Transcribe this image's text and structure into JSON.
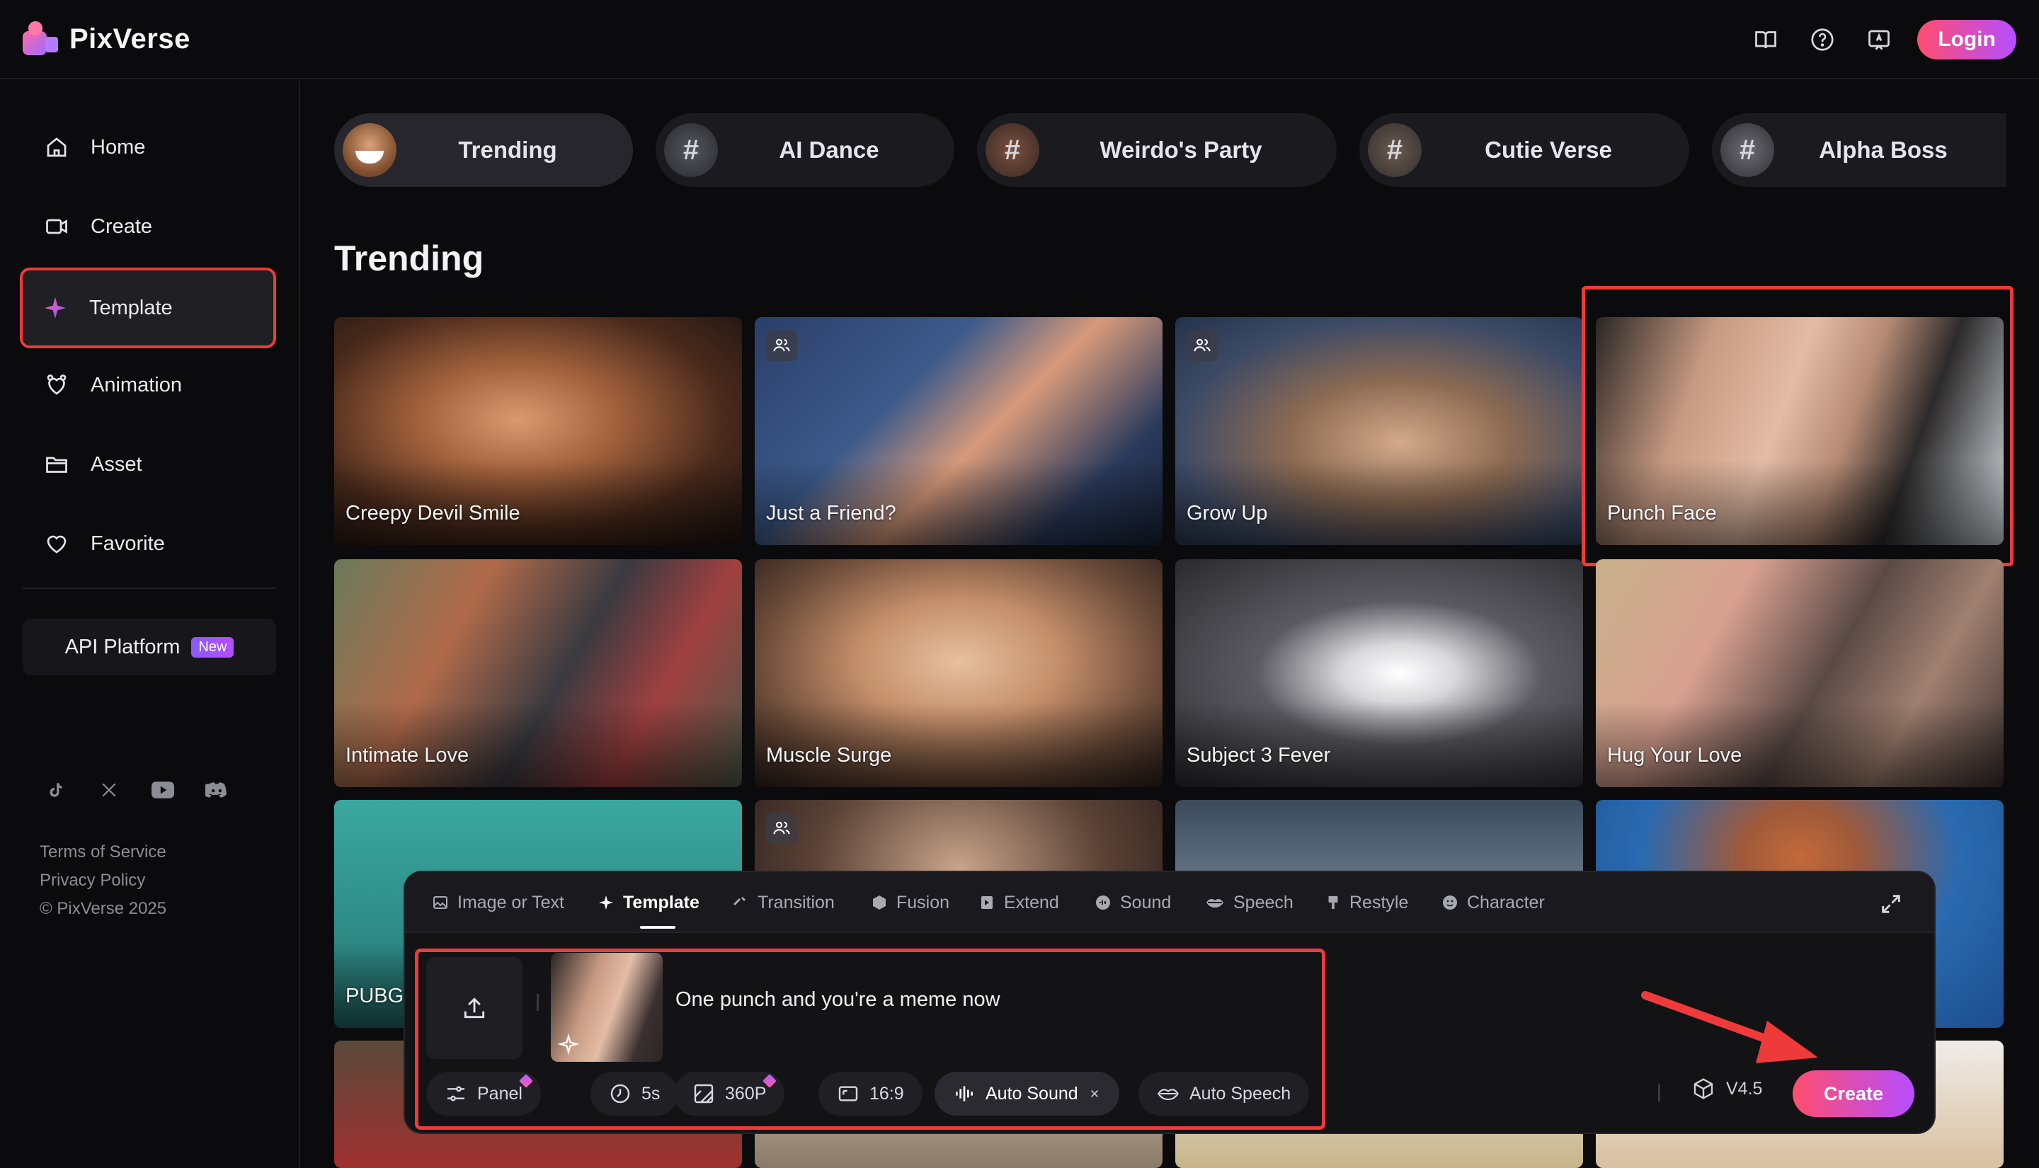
{
  "app": {
    "name": "PixVerse"
  },
  "header": {
    "login_label": "Login",
    "icons": [
      "book-icon",
      "help-icon",
      "feedback-icon"
    ]
  },
  "sidebar": {
    "items": [
      {
        "label": "Home",
        "icon": "home-icon"
      },
      {
        "label": "Create",
        "icon": "video-camera-icon"
      },
      {
        "label": "Template",
        "icon": "sparkle-icon",
        "active": true
      },
      {
        "label": "Animation",
        "icon": "animation-icon"
      },
      {
        "label": "Asset",
        "icon": "folder-icon"
      },
      {
        "label": "Favorite",
        "icon": "heart-icon"
      }
    ],
    "api_label": "API Platform",
    "api_badge": "New",
    "socials": [
      "tiktok-icon",
      "x-icon",
      "youtube-icon",
      "discord-icon"
    ],
    "footer": {
      "terms": "Terms of Service",
      "privacy": "Privacy Policy",
      "copyright": "© PixVerse 2025"
    }
  },
  "categories": [
    {
      "label": "Trending",
      "active": true
    },
    {
      "label": "AI Dance"
    },
    {
      "label": "Weirdo's Party"
    },
    {
      "label": "Cutie Verse"
    },
    {
      "label": "Alpha Boss"
    }
  ],
  "section_title": "Trending",
  "cards": [
    {
      "title": "Creepy Devil Smile"
    },
    {
      "title": "Just a Friend?",
      "multi": true
    },
    {
      "title": "Grow Up",
      "multi": true
    },
    {
      "title": "Punch Face",
      "highlighted": true
    },
    {
      "title": "Intimate Love"
    },
    {
      "title": "Muscle Surge"
    },
    {
      "title": "Subject 3 Fever"
    },
    {
      "title": "Hug Your Love"
    },
    {
      "title": "PUBG"
    },
    {
      "title": "",
      "multi": true
    },
    {
      "title": ""
    },
    {
      "title": ""
    }
  ],
  "composer": {
    "tabs": [
      {
        "label": "Image or Text",
        "icon": "image-icon"
      },
      {
        "label": "Template",
        "icon": "sparkle-icon",
        "active": true
      },
      {
        "label": "Transition",
        "icon": "transition-icon"
      },
      {
        "label": "Fusion",
        "icon": "cube-icon"
      },
      {
        "label": "Extend",
        "icon": "extend-icon"
      },
      {
        "label": "Sound",
        "icon": "sound-icon"
      },
      {
        "label": "Speech",
        "icon": "lips-icon"
      },
      {
        "label": "Restyle",
        "icon": "brush-icon"
      },
      {
        "label": "Character",
        "icon": "character-icon"
      }
    ],
    "prompt": "One punch and you're a meme now",
    "chips": {
      "panel": "Panel",
      "duration": "5s",
      "quality": "360P",
      "ratio": "16:9",
      "auto_sound": "Auto Sound",
      "auto_speech": "Auto Speech"
    },
    "version": "V4.5",
    "create_label": "Create"
  },
  "colors": {
    "accent_start": "#ff4d6d",
    "accent_end": "#b64dff",
    "highlight": "#ef3a3a",
    "background": "#0b0b0d"
  }
}
